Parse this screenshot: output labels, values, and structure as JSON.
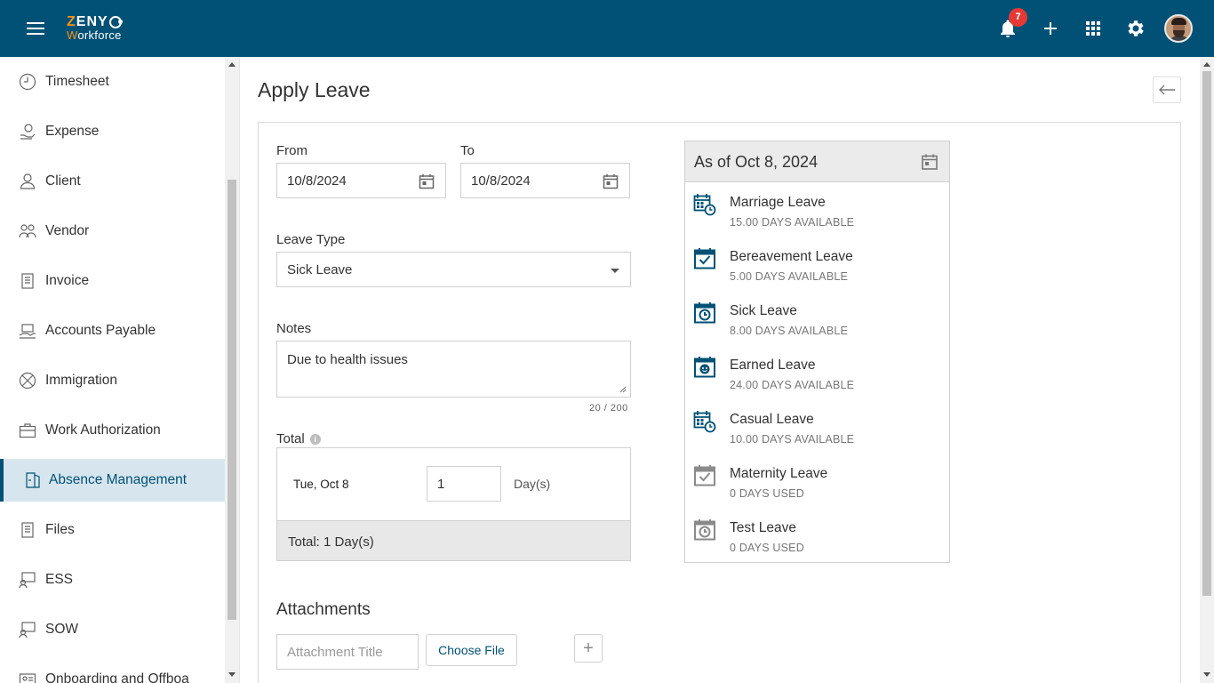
{
  "header": {
    "logo_top_a": "ZENY",
    "logo_sub": "Workforce",
    "notification_count": "7"
  },
  "sidebar": {
    "items": [
      {
        "label": "Timesheet",
        "icon": "clock-icon"
      },
      {
        "label": "Expense",
        "icon": "money-hand-icon"
      },
      {
        "label": "Client",
        "icon": "person-icon"
      },
      {
        "label": "Vendor",
        "icon": "people-icon"
      },
      {
        "label": "Invoice",
        "icon": "document-icon"
      },
      {
        "label": "Accounts Payable",
        "icon": "handshake-icon"
      },
      {
        "label": "Immigration",
        "icon": "globe-icon"
      },
      {
        "label": "Work Authorization",
        "icon": "briefcase-icon"
      },
      {
        "label": "Absence Management",
        "icon": "door-exit-icon",
        "active": true
      },
      {
        "label": "Files",
        "icon": "files-icon"
      },
      {
        "label": "ESS",
        "icon": "monitor-people-icon"
      },
      {
        "label": "SOW",
        "icon": "monitor-people-icon"
      },
      {
        "label": "Onboarding and Offboa",
        "icon": "id-card-icon"
      }
    ]
  },
  "page": {
    "title": "Apply Leave"
  },
  "form": {
    "from_label": "From",
    "from_value": "10/8/2024",
    "to_label": "To",
    "to_value": "10/8/2024",
    "leave_type_label": "Leave Type",
    "leave_type_value": "Sick Leave",
    "notes_label": "Notes",
    "notes_value": "Due to health issues",
    "notes_counter": "20 / 200",
    "total_label": "Total",
    "total_date": "Tue, Oct 8",
    "total_days_value": "1",
    "total_days_unit": "Day(s)",
    "total_footer": "Total: 1 Day(s)",
    "attachments_label": "Attachments",
    "attachment_placeholder": "Attachment Title",
    "choose_file_label": "Choose File",
    "add_label": "+"
  },
  "balance": {
    "as_of": "As of Oct 8, 2024",
    "leaves": [
      {
        "name": "Marriage Leave",
        "value": "15.00 DAYS AVAILABLE",
        "icon": "calendar-clock-icon",
        "color": "#005175"
      },
      {
        "name": "Bereavement Leave",
        "value": "5.00 DAYS AVAILABLE",
        "icon": "calendar-check-icon",
        "color": "#005175"
      },
      {
        "name": "Sick Leave",
        "value": "8.00 DAYS AVAILABLE",
        "icon": "calendar-alarm-icon",
        "color": "#005175"
      },
      {
        "name": "Earned Leave",
        "value": "24.00 DAYS AVAILABLE",
        "icon": "calendar-smile-icon",
        "color": "#005175"
      },
      {
        "name": "Casual Leave",
        "value": "10.00 DAYS AVAILABLE",
        "icon": "calendar-clock-icon",
        "color": "#005175"
      },
      {
        "name": "Maternity Leave",
        "value": "0 DAYS USED",
        "icon": "calendar-check-icon",
        "color": "#8a8a8a"
      },
      {
        "name": "Test Leave",
        "value": "0 DAYS USED",
        "icon": "calendar-alarm-icon",
        "color": "#8a8a8a"
      }
    ]
  },
  "colors": {
    "brand": "#005175",
    "accent": "#f7941d",
    "badge": "#e53935"
  }
}
